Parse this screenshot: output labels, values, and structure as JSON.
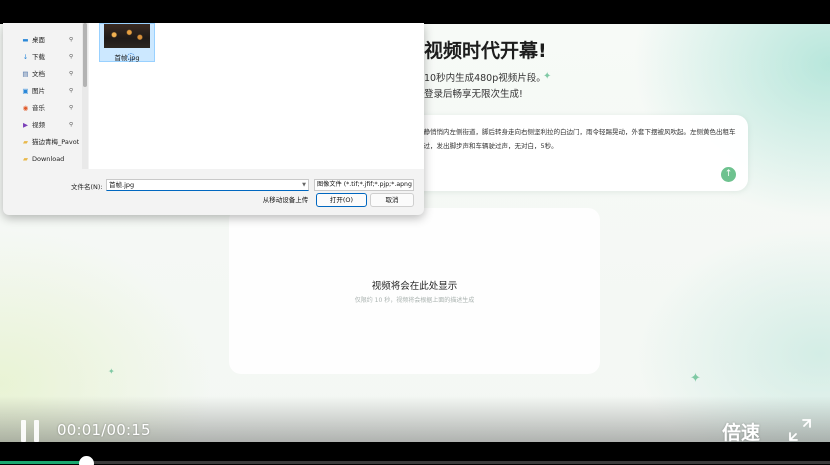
{
  "webpage": {
    "hero_title": "视频时代开幕!",
    "hero_line1": "10秒内生成480p视频片段。",
    "hero_line2": "登录后畅享无限次生成!",
    "prompt_text": "夜静悄悄内左侧街道，脚后转身走向右侧坚利拉的白边门，雨令轻踢晃动，外套下摆被风吹起。左侧黄色出租车驶过，发出脚步声和车辆驶过声，无对白，5秒。",
    "preview_title": "视频将会在此处显示",
    "preview_subtitle": "仅限约 10 秒，视频将会根据上面的描述生成"
  },
  "file_dialog": {
    "nav_items": [
      {
        "label": "桌面",
        "icon": "desktop-icon",
        "glyph": "▬",
        "color": "#2b88d8"
      },
      {
        "label": "下载",
        "icon": "download-icon",
        "glyph": "↓",
        "color": "#2b88d8"
      },
      {
        "label": "文档",
        "icon": "document-icon",
        "glyph": "▤",
        "color": "#4a6fa5"
      },
      {
        "label": "图片",
        "icon": "pictures-icon",
        "glyph": "▣",
        "color": "#2b88d8"
      },
      {
        "label": "音乐",
        "icon": "music-icon",
        "glyph": "◉",
        "color": "#e05a2a"
      },
      {
        "label": "视频",
        "icon": "video-icon",
        "glyph": "▶",
        "color": "#7a3fb8"
      },
      {
        "label": "猫边青梅_Pavot",
        "icon": "folder-icon",
        "glyph": "▰",
        "color": "#e8b84a"
      },
      {
        "label": "Download",
        "icon": "folder-icon",
        "glyph": "▰",
        "color": "#e8b84a"
      }
    ],
    "pin_glyph": "📌",
    "selected_file": "首帧.jpg",
    "filename_label": "文件名(N):",
    "filename_value": "首帧.jpg",
    "filetype_value": "图像文件 (*.tif;*.jfif;*.pjp;*.apng",
    "upload_mobile_label": "从移动设备上传",
    "open_label": "打开(O)",
    "cancel_label": "取消"
  },
  "player": {
    "time": "00:01/00:15",
    "speed_label": "倍速",
    "progress": 0.104,
    "accent": "#1aa870"
  }
}
